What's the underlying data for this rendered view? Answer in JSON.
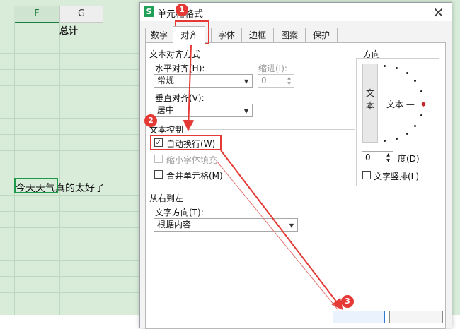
{
  "sheet": {
    "columns": [
      {
        "label": "F",
        "selected": true
      },
      {
        "label": "G",
        "selected": false
      }
    ],
    "header_cell": "总计",
    "cell_text": "今天天气真的太好了"
  },
  "dialog": {
    "title": "单元格格式",
    "app_icon": "S",
    "close_icon": "×",
    "tabs": [
      "数字",
      "对齐",
      "字体",
      "边框",
      "图案",
      "保护"
    ],
    "active_tab": "对齐",
    "text_align_group": "文本对齐方式",
    "horizontal_label": "水平对齐(H):",
    "horizontal_value": "常规",
    "indent_label": "缩进(I):",
    "indent_value": "0",
    "vertical_label": "垂直对齐(V):",
    "vertical_value": "居中",
    "text_control_group": "文本控制",
    "wrap_text": {
      "label": "自动换行(W)",
      "checked": true
    },
    "shrink_to_fit": {
      "label": "缩小字体填充",
      "checked": false,
      "disabled": true
    },
    "merge_cells": {
      "label": "合并单元格(M)",
      "checked": false
    },
    "rtl_group": "从右到左",
    "text_direction_label": "文字方向(T):",
    "text_direction_value": "根据内容",
    "orientation_group": "方向",
    "orientation_vertical_text": "文本",
    "orientation_horizontal_text": "文本 —",
    "degree_value": "0",
    "degree_label": "度(D)",
    "vertical_text": {
      "label": "文字竖排(L)",
      "checked": false
    }
  },
  "annotations": {
    "badges": [
      "1",
      "2",
      "3"
    ],
    "color": "#e53935"
  }
}
